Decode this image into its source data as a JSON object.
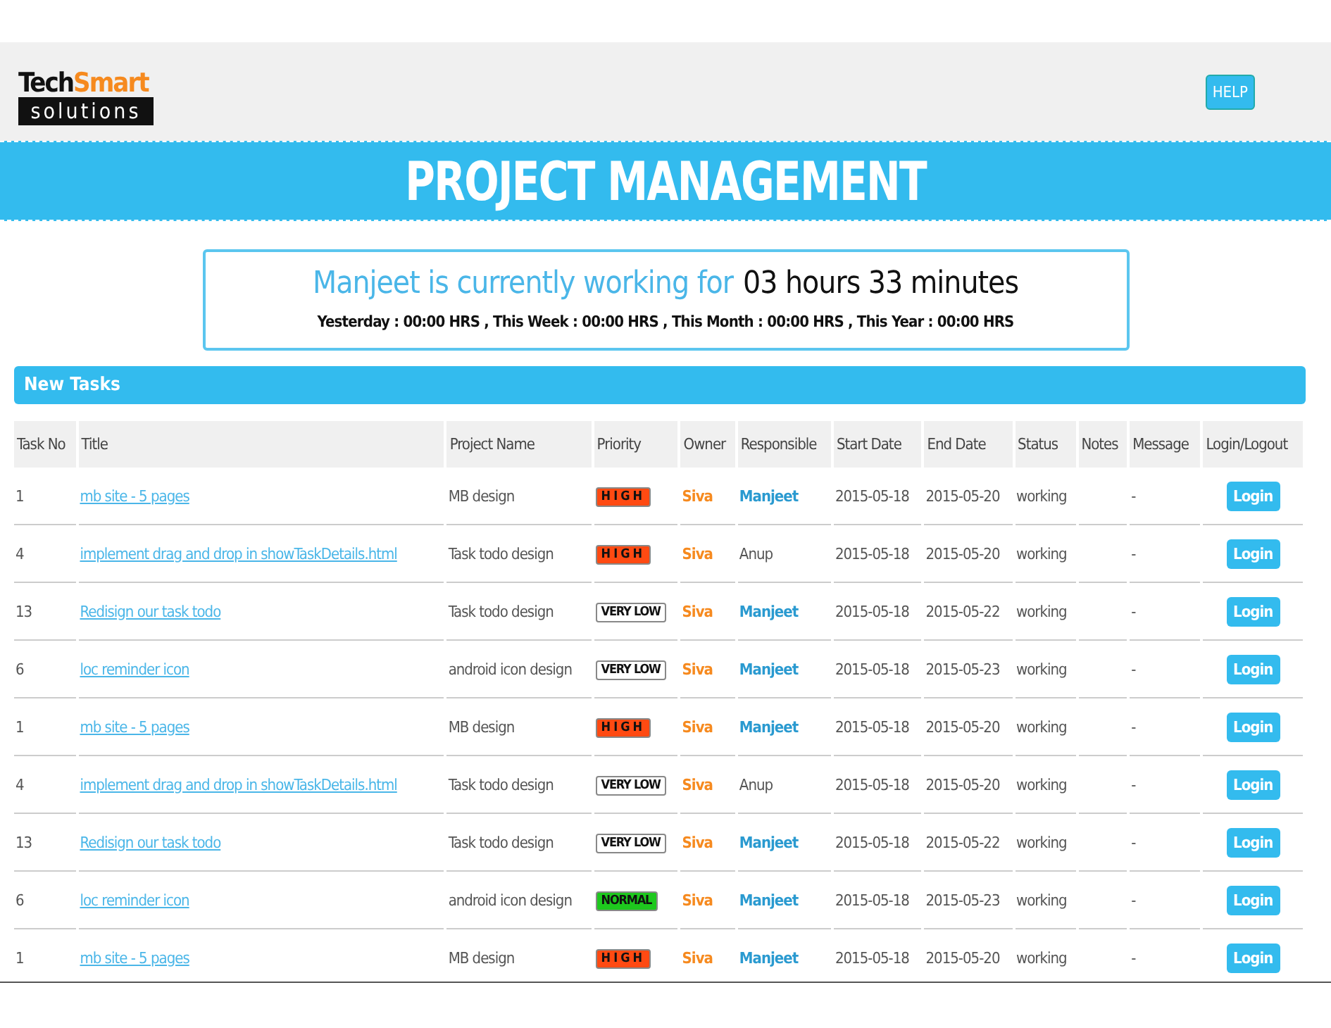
{
  "logo": {
    "word_1": "Tech",
    "word_2": "Smart",
    "word_3": "solutions"
  },
  "help_button": "HELP",
  "banner": "PROJECT MANAGEMENT",
  "status_card": {
    "lead": "Manjeet is currently working for",
    "duration": "03 hours 33 minutes",
    "summary": "Yesterday : 00:00 HRS , This Week : 00:00 HRS , This Month : 00:00 HRS , This Year : 00:00 HRS"
  },
  "section_title": "New Tasks",
  "table": {
    "columns": [
      "Task No",
      "Title",
      "Project Name",
      "Priority",
      "Owner",
      "Responsible",
      "Start Date",
      "End Date",
      "Status",
      "Notes",
      "Message",
      "Login/Logout"
    ],
    "rows": [
      {
        "task_no": "1",
        "title": "mb site - 5 pages",
        "project": "MB design",
        "priority": {
          "kind": "high",
          "label": "HIGH"
        },
        "owner": "Siva",
        "responsible": "Manjeet",
        "highlighted": true,
        "start": "2015-05-18",
        "end": "2015-05-20",
        "status": "working",
        "message": "-",
        "action": "Login"
      },
      {
        "task_no": "4",
        "title": "implement drag and drop in showTaskDetails.html",
        "project": "Task todo design",
        "priority": {
          "kind": "high",
          "label": "HIGH"
        },
        "owner": "Siva",
        "responsible": "Anup",
        "highlighted": false,
        "start": "2015-05-18",
        "end": "2015-05-20",
        "status": "working",
        "message": "-",
        "action": "Login"
      },
      {
        "task_no": "13",
        "title": "Redisign our task todo",
        "project": "Task todo design",
        "priority": {
          "kind": "very_low",
          "label": "VERY LOW"
        },
        "owner": "Siva",
        "responsible": "Manjeet",
        "highlighted": true,
        "start": "2015-05-18",
        "end": "2015-05-22",
        "status": "working",
        "message": "-",
        "action": "Login"
      },
      {
        "task_no": "6",
        "title": "loc reminder icon",
        "project": "android icon design",
        "priority": {
          "kind": "very_low",
          "label": "VERY LOW"
        },
        "owner": "Siva",
        "responsible": "Manjeet",
        "highlighted": true,
        "start": "2015-05-18",
        "end": "2015-05-23",
        "status": "working",
        "message": "-",
        "action": "Login"
      },
      {
        "task_no": "1",
        "title": "mb site - 5 pages",
        "project": "MB design",
        "priority": {
          "kind": "high",
          "label": "HIGH"
        },
        "owner": "Siva",
        "responsible": "Manjeet",
        "highlighted": true,
        "start": "2015-05-18",
        "end": "2015-05-20",
        "status": "working",
        "message": "-",
        "action": "Login"
      },
      {
        "task_no": "4",
        "title": "implement drag and drop in showTaskDetails.html",
        "project": "Task todo design",
        "priority": {
          "kind": "very_low",
          "label": "VERY LOW"
        },
        "owner": "Siva",
        "responsible": "Anup",
        "highlighted": false,
        "start": "2015-05-18",
        "end": "2015-05-20",
        "status": "working",
        "message": "-",
        "action": "Login"
      },
      {
        "task_no": "13",
        "title": "Redisign our task todo",
        "project": "Task todo design",
        "priority": {
          "kind": "very_low",
          "label": "VERY LOW"
        },
        "owner": "Siva",
        "responsible": "Manjeet",
        "highlighted": true,
        "start": "2015-05-18",
        "end": "2015-05-22",
        "status": "working",
        "message": "-",
        "action": "Login"
      },
      {
        "task_no": "6",
        "title": "loc reminder icon",
        "project": "android icon design",
        "priority": {
          "kind": "normal",
          "label": "NORMAL"
        },
        "owner": "Siva",
        "responsible": "Manjeet",
        "highlighted": true,
        "start": "2015-05-18",
        "end": "2015-05-23",
        "status": "working",
        "message": "-",
        "action": "Login"
      },
      {
        "task_no": "1",
        "title": "mb site - 5 pages",
        "project": "MB design",
        "priority": {
          "kind": "high",
          "label": "HIGH"
        },
        "owner": "Siva",
        "responsible": "Manjeet",
        "highlighted": true,
        "start": "2015-05-18",
        "end": "2015-05-20",
        "status": "working",
        "message": "-",
        "action": "Login"
      }
    ]
  }
}
